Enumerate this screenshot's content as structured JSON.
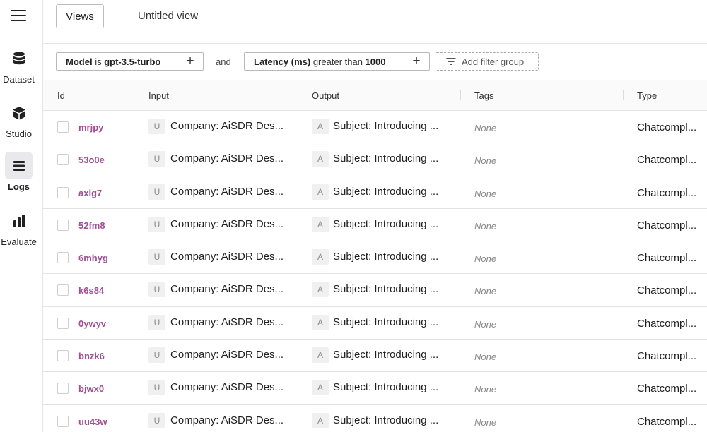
{
  "nav": {
    "items": [
      {
        "label": "Dataset",
        "icon": "database-icon"
      },
      {
        "label": "Studio",
        "icon": "cube-icon"
      },
      {
        "label": "Logs",
        "icon": "stack-icon"
      },
      {
        "label": "Evaluate",
        "icon": "bar-chart-icon"
      }
    ],
    "active": "Logs"
  },
  "topbar": {
    "views_label": "Views",
    "view_name": "Untitled view"
  },
  "filters": {
    "chip1": {
      "field": "Model",
      "op": "is",
      "value": "gpt-3.5-turbo"
    },
    "joiner": "and",
    "chip2": {
      "field": "Latency (ms)",
      "op": "greater than",
      "value": "1000"
    },
    "add_group_label": "Add filter group"
  },
  "table": {
    "columns": [
      "Id",
      "Input",
      "Output",
      "Tags",
      "Type"
    ],
    "rows": [
      {
        "id": "mrjpy",
        "input_role": "U",
        "input": "Company: AiSDR Des...",
        "output_role": "A",
        "output": "Subject: Introducing ...",
        "tags": "None",
        "type": "Chatcompl..."
      },
      {
        "id": "53o0e",
        "input_role": "U",
        "input": "Company: AiSDR Des...",
        "output_role": "A",
        "output": "Subject: Introducing ...",
        "tags": "None",
        "type": "Chatcompl..."
      },
      {
        "id": "axlg7",
        "input_role": "U",
        "input": "Company: AiSDR Des...",
        "output_role": "A",
        "output": "Subject: Introducing ...",
        "tags": "None",
        "type": "Chatcompl..."
      },
      {
        "id": "52fm8",
        "input_role": "U",
        "input": "Company: AiSDR Des...",
        "output_role": "A",
        "output": "Subject: Introducing ...",
        "tags": "None",
        "type": "Chatcompl..."
      },
      {
        "id": "6mhyg",
        "input_role": "U",
        "input": "Company: AiSDR Des...",
        "output_role": "A",
        "output": "Subject: Introducing ...",
        "tags": "None",
        "type": "Chatcompl..."
      },
      {
        "id": "k6s84",
        "input_role": "U",
        "input": "Company: AiSDR Des...",
        "output_role": "A",
        "output": "Subject: Introducing ...",
        "tags": "None",
        "type": "Chatcompl..."
      },
      {
        "id": "0ywyv",
        "input_role": "U",
        "input": "Company: AiSDR Des...",
        "output_role": "A",
        "output": "Subject: Introducing ...",
        "tags": "None",
        "type": "Chatcompl..."
      },
      {
        "id": "bnzk6",
        "input_role": "U",
        "input": "Company: AiSDR Des...",
        "output_role": "A",
        "output": "Subject: Introducing ...",
        "tags": "None",
        "type": "Chatcompl..."
      },
      {
        "id": "bjwx0",
        "input_role": "U",
        "input": "Company: AiSDR Des...",
        "output_role": "A",
        "output": "Subject: Introducing ...",
        "tags": "None",
        "type": "Chatcompl..."
      },
      {
        "id": "uu43w",
        "input_role": "U",
        "input": "Company: AiSDR Des...",
        "output_role": "A",
        "output": "Subject: Introducing ...",
        "tags": "None",
        "type": "Chatcompl..."
      }
    ]
  },
  "colors": {
    "id_link": "#a04f95",
    "active_nav_bg": "#e9e9ec",
    "border": "#e3e3e3"
  }
}
